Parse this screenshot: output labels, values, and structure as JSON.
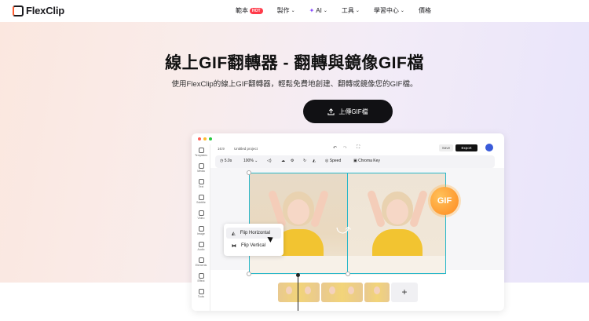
{
  "nav": {
    "logo": "FlexClip",
    "items": [
      {
        "label": "範本",
        "badge": "HOT"
      },
      {
        "label": "製作"
      },
      {
        "label": "AI"
      },
      {
        "label": "工具"
      },
      {
        "label": "學習中心"
      },
      {
        "label": "價格"
      }
    ]
  },
  "hero": {
    "title": "線上GIF翻轉器 - 翻轉與鏡像GIF檔",
    "subtitle": "使用FlexClip的線上GIF翻轉器，輕鬆免費地創建、翻轉或鏡像您的GIF檔。",
    "cta_label": "上傳GIF檔"
  },
  "editor": {
    "aspect": "16:9",
    "project_name": "Untitled project",
    "save_label": "Save",
    "export_label": "Export",
    "sidebar": [
      "Templates",
      "Media",
      "Text",
      "Subtitle",
      "Video",
      "Image",
      "Audio",
      "Elements",
      "Effect",
      "Tools"
    ],
    "toolbar": {
      "duration": "5.0s",
      "zoom": "100%",
      "speed_label": "Speed",
      "chroma_label": "Chroma Key"
    },
    "flip_menu": {
      "horizontal": "Flip Horizontal",
      "vertical": "Flip Vertical"
    },
    "gif_badge": "GIF",
    "add_clip": "+"
  },
  "colors": {
    "accent_cyan": "#27b7c9",
    "badge_orange": "#ff8a1f",
    "cta_bg": "#111114",
    "hot_red": "#ff3b4a"
  }
}
